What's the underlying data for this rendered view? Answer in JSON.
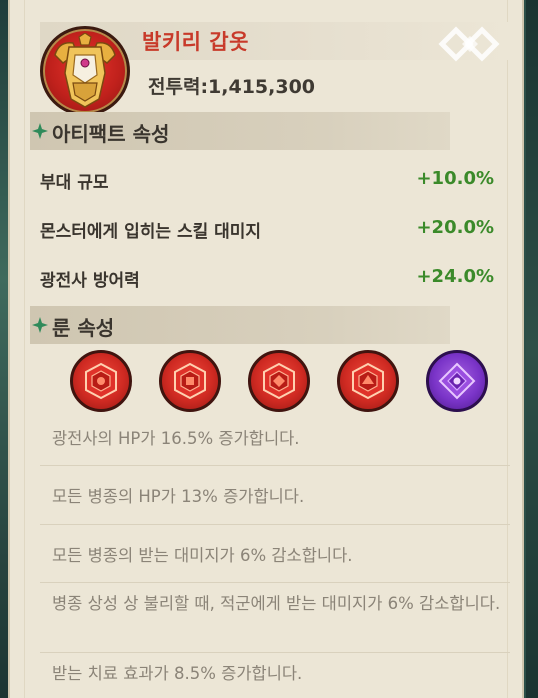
{
  "item": {
    "name": "발키리 갑옷",
    "power_label": "전투력:1,415,300"
  },
  "artifact_section": {
    "title": "아티팩트 속성",
    "attributes": [
      {
        "name": "부대 규모",
        "value": "+10.0%"
      },
      {
        "name": "몬스터에게 입히는 스킬 대미지",
        "value": "+20.0%"
      },
      {
        "name": "광전사 방어력",
        "value": "+24.0%"
      }
    ]
  },
  "rune_section": {
    "title": "룬 속성",
    "runes": [
      {
        "color": "red"
      },
      {
        "color": "red"
      },
      {
        "color": "red"
      },
      {
        "color": "red"
      },
      {
        "color": "purple"
      }
    ],
    "effects": [
      "광전사의 HP가 16.5% 증가합니다.",
      "모든 병종의 HP가 13% 증가합니다.",
      "모든 병종의 받는 대미지가 6% 감소합니다.",
      "병종 상성 상 불리할 때, 적군에게 받는 대미지가 6% 감소합니다.",
      "받는 치료 효과가 8.5% 증가합니다."
    ]
  },
  "colors": {
    "item_name": "#c83a2a",
    "value_positive": "#3b8a2a",
    "section_diamond": "#2f8a5a",
    "panel_bg": "#ece6d6"
  },
  "icons": {
    "item": "armor-icon",
    "ornament": "diamond-ornament-icon",
    "section_marker": "green-diamond-icon",
    "rune_red": "red-rune-gem-icon",
    "rune_purple": "purple-rune-gem-icon"
  }
}
